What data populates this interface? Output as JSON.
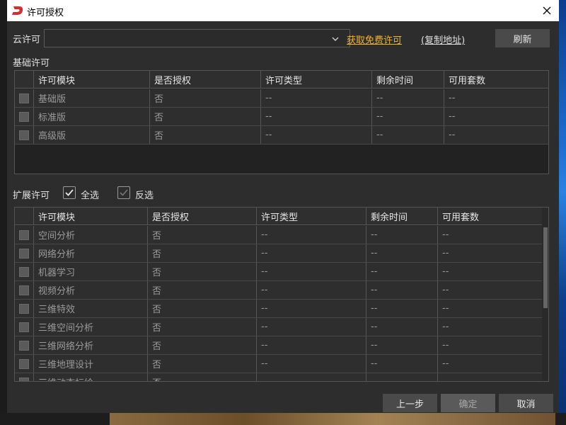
{
  "window": {
    "title": "许可授权"
  },
  "cloud": {
    "label": "云许可",
    "selected": "",
    "get_free_link": "获取免费许可",
    "copy_address_link": "(复制地址)",
    "refresh_button": "刷新"
  },
  "colors": {
    "accent_link": "#f0b429",
    "title_logo": "#d32f2f"
  },
  "basic": {
    "section_label": "基础许可",
    "columns": [
      "许可模块",
      "是否授权",
      "许可类型",
      "剩余时间",
      "可用套数"
    ],
    "rows": [
      [
        "基础版",
        "否",
        "--",
        "--",
        "--"
      ],
      [
        "标准版",
        "否",
        "--",
        "--",
        "--"
      ],
      [
        "高级版",
        "否",
        "--",
        "--",
        "--"
      ]
    ]
  },
  "extended": {
    "section_label": "扩展许可",
    "select_all": {
      "label": "全选",
      "checked": true
    },
    "invert": {
      "label": "反选",
      "checked": false
    },
    "columns": [
      "许可模块",
      "是否授权",
      "许可类型",
      "剩余时间",
      "可用套数"
    ],
    "rows": [
      [
        "空间分析",
        "否",
        "--",
        "--",
        "--"
      ],
      [
        "网络分析",
        "否",
        "--",
        "--",
        "--"
      ],
      [
        "机器学习",
        "否",
        "--",
        "--",
        "--"
      ],
      [
        "视频分析",
        "否",
        "--",
        "--",
        "--"
      ],
      [
        "三维特效",
        "否",
        "--",
        "--",
        "--"
      ],
      [
        "三维空间分析",
        "否",
        "--",
        "--",
        "--"
      ],
      [
        "三维网络分析",
        "否",
        "--",
        "--",
        "--"
      ],
      [
        "三维地理设计",
        "否",
        "--",
        "--",
        "--"
      ],
      [
        "三维动态标绘",
        "否",
        "--",
        "--",
        "--"
      ]
    ]
  },
  "footer": {
    "prev_button": "上一步",
    "ok_button": "确定",
    "cancel_button": "取消"
  }
}
